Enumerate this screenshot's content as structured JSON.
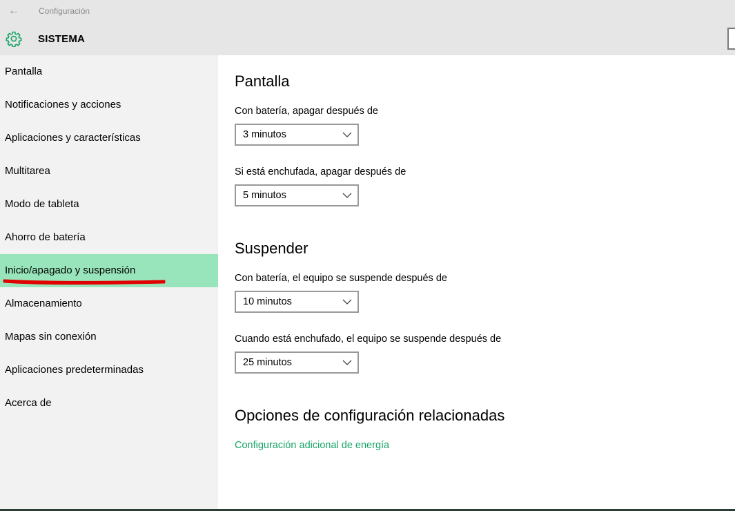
{
  "window": {
    "title": "Configuración",
    "back_icon": "arrow-left-icon"
  },
  "header": {
    "section": "SISTEMA",
    "icon": "gear-icon",
    "accent": "#16a466"
  },
  "sidebar": {
    "items": [
      {
        "label": "Pantalla"
      },
      {
        "label": "Notificaciones y acciones"
      },
      {
        "label": "Aplicaciones y características"
      },
      {
        "label": "Multitarea"
      },
      {
        "label": "Modo de tableta"
      },
      {
        "label": "Ahorro de batería"
      },
      {
        "label": "Inicio/apagado y suspensión",
        "selected": true
      },
      {
        "label": "Almacenamiento"
      },
      {
        "label": "Mapas sin conexión"
      },
      {
        "label": "Aplicaciones predeterminadas"
      },
      {
        "label": "Acerca de"
      }
    ],
    "selected_color": "#99e5bb",
    "annotation_color": "#e00000"
  },
  "content": {
    "screen": {
      "heading": "Pantalla",
      "battery_label": "Con batería, apagar después de",
      "battery_value": "3 minutos",
      "plugged_label": "Si está enchufada, apagar después de",
      "plugged_value": "5 minutos"
    },
    "sleep": {
      "heading": "Suspender",
      "battery_label": "Con batería, el equipo se suspende después de",
      "battery_value": "10 minutos",
      "plugged_label": "Cuando está enchufado, el equipo se suspende después de",
      "plugged_value": "25 minutos"
    },
    "related": {
      "heading": "Opciones de configuración relacionadas",
      "link": "Configuración adicional de energía"
    }
  }
}
